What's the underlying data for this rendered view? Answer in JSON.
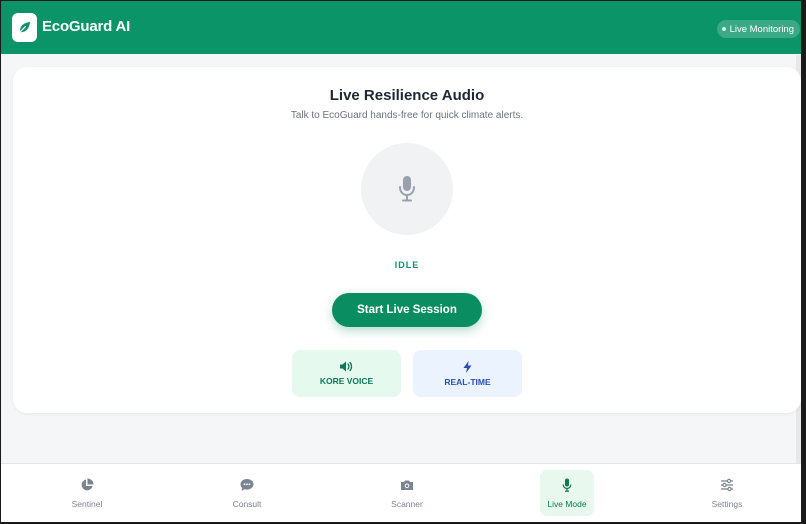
{
  "header": {
    "app_title": "EcoGuard AI",
    "status_label": "Live Monitoring",
    "logo_icon": "leaf-icon"
  },
  "main": {
    "title": "Live Resilience Audio",
    "subtitle": "Talk to EcoGuard hands-free for quick climate alerts.",
    "mic_icon": "microphone-icon",
    "state": "IDLE",
    "start_button": "Start Live Session",
    "features": [
      {
        "label": "KORE VOICE",
        "icon": "speaker-icon"
      },
      {
        "label": "REAL-TIME",
        "icon": "lightning-icon"
      }
    ]
  },
  "nav": {
    "items": [
      {
        "label": "Sentinel",
        "icon": "pie-chart-icon",
        "active": false
      },
      {
        "label": "Consult",
        "icon": "chat-bubble-icon",
        "active": false
      },
      {
        "label": "Scanner",
        "icon": "camera-icon",
        "active": false
      },
      {
        "label": "Live Mode",
        "icon": "microphone-icon",
        "active": true
      },
      {
        "label": "Settings",
        "icon": "sliders-icon",
        "active": false
      }
    ]
  },
  "colors": {
    "brand": "#0b9468",
    "voice_bg": "#e6f9ee",
    "realtime_bg": "#ebf3ff",
    "realtime_text": "#2a4fb0"
  }
}
